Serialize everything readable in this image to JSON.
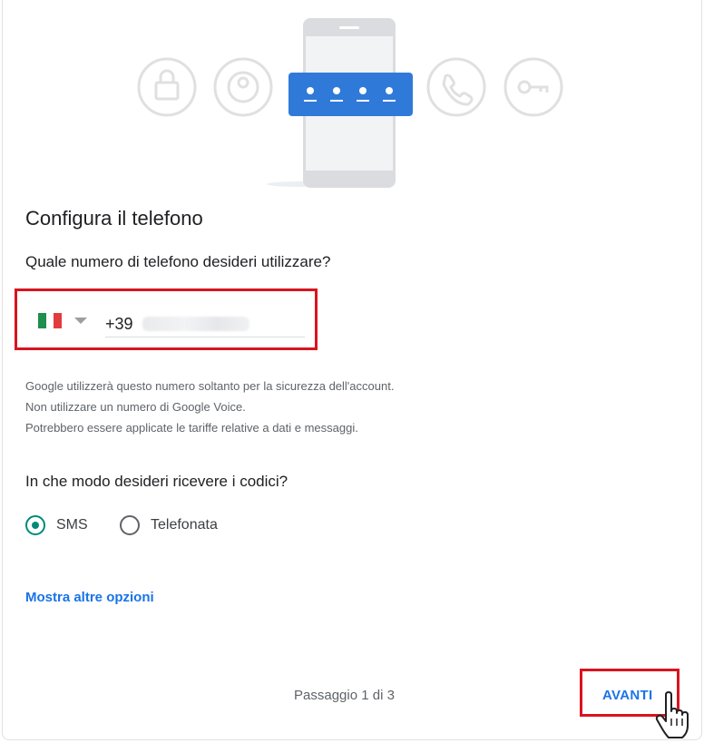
{
  "page": {
    "title": "Configura il telefono",
    "phone_question": "Quale numero di telefono desideri utilizzare?",
    "country_prefix": "+39",
    "info_lines": [
      "Google utilizzerà questo numero soltanto per la sicurezza dell'account.",
      "Non utilizzare un numero di Google Voice.",
      "Potrebbero essere applicate le tariffe relative a dati e messaggi."
    ],
    "method_question": "In che modo desideri ricevere i codici?",
    "methods": [
      {
        "label": "SMS",
        "selected": true
      },
      {
        "label": "Telefonata",
        "selected": false
      }
    ],
    "more_options": "Mostra altre opzioni",
    "step_text": "Passaggio 1 di 3",
    "next_label": "AVANTI"
  },
  "icons": [
    "lock-icon",
    "account-icon",
    "phone-icon",
    "key-icon",
    "hand-cursor-icon",
    "italy-flag-icon"
  ],
  "colors": {
    "accent": "#1a73e8",
    "highlight_border": "#d9141f",
    "radio_selected": "#00897b"
  }
}
